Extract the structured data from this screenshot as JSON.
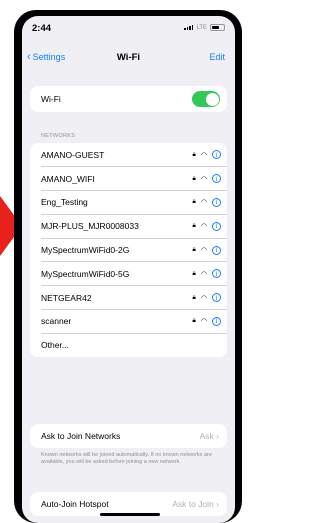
{
  "status_bar": {
    "time": "2:44",
    "carrier": "LTE"
  },
  "nav": {
    "back_label": "Settings",
    "title": "Wi-Fi",
    "edit_label": "Edit"
  },
  "wifi_toggle": {
    "label": "Wi-Fi",
    "on": true
  },
  "networks_header": "NETWORKS",
  "networks": [
    {
      "name": "AMANO-GUEST"
    },
    {
      "name": "AMANO_WIFI"
    },
    {
      "name": "Eng_Testing"
    },
    {
      "name": "MJR-PLUS_MJR0008033"
    },
    {
      "name": "MySpectrumWiFid0-2G"
    },
    {
      "name": "MySpectrumWiFid0-5G"
    },
    {
      "name": "NETGEAR42"
    },
    {
      "name": "scanner"
    }
  ],
  "other_label": "Other...",
  "ask_to_join": {
    "label": "Ask to Join Networks",
    "value": "Ask",
    "footnote": "Known networks will be joined automatically. If no known networks are available, you will be asked before joining a new network."
  },
  "auto_join": {
    "label": "Auto-Join Hotspot",
    "value": "Ask to Join"
  },
  "colors": {
    "accent": "#147efb",
    "toggle_on": "#34c759",
    "arrow": "#e8211c"
  },
  "icons": {
    "lock": "lock-icon",
    "wifi": "wifi-icon",
    "info": "info-icon"
  }
}
